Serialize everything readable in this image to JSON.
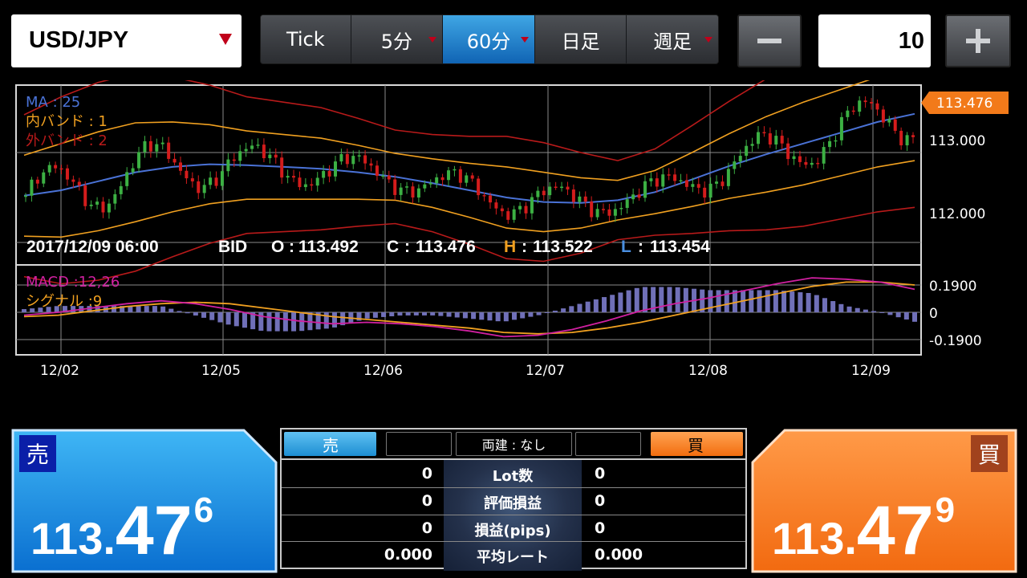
{
  "toolbar": {
    "pair": "USD/JPY",
    "timeframes": [
      {
        "label": "Tick",
        "active": false,
        "has_menu": false
      },
      {
        "label": "5分",
        "active": false,
        "has_menu": true
      },
      {
        "label": "60分",
        "active": true,
        "has_menu": true
      },
      {
        "label": "日足",
        "active": false,
        "has_menu": false
      },
      {
        "label": "週足",
        "active": false,
        "has_menu": true
      }
    ],
    "quantity": "10"
  },
  "chart": {
    "legend": {
      "ma": "MA : 25",
      "inner_band": "内バンド : 1",
      "outer_band": "外バンド : 2"
    },
    "macd_legend": {
      "macd": "MACD :12,26",
      "signal": "シグナル :9"
    },
    "ohlc": {
      "datetime": "2017/12/09 06:00",
      "side": "BID",
      "open_label": "O",
      "open": "113.492",
      "close_label": "C",
      "close": "113.476",
      "high_label": "H",
      "high": "113.522",
      "low_label": "L",
      "low": "113.454"
    },
    "current_price_tag": "113.476",
    "colors": {
      "ma": "#4a72d6",
      "inner_band": "#f0a020",
      "outer_band": "#b81a1a",
      "macd": "#d020a0",
      "signal": "#f0a020",
      "histogram": "#7070b8",
      "price_tag": "#f27a1a",
      "up_candle": "#3cb043",
      "down_candle": "#d41c1c"
    }
  },
  "chart_data": {
    "type": "line",
    "x_dates": [
      "12/02",
      "12/05",
      "12/06",
      "12/07",
      "12/08",
      "12/09"
    ],
    "price_axis_ticks": [
      "113.000",
      "112.000"
    ],
    "price_axis_range": [
      111.75,
      113.75
    ],
    "macd_axis_ticks": [
      "0.1900",
      "0",
      "-0.1900"
    ],
    "series": [
      {
        "name": "MA",
        "values": [
          112.52,
          112.58,
          112.68,
          112.78,
          112.84,
          112.87,
          112.86,
          112.84,
          112.82,
          112.78,
          112.73,
          112.66,
          112.58,
          112.5,
          112.45,
          112.44,
          112.47,
          112.56,
          112.7,
          112.85,
          112.98,
          113.1,
          113.22,
          113.34,
          113.43
        ]
      },
      {
        "name": "MACD",
        "values": [
          -0.02,
          0.0,
          0.03,
          0.06,
          0.08,
          0.06,
          0.02,
          -0.03,
          -0.06,
          -0.08,
          -0.07,
          -0.08,
          -0.1,
          -0.13,
          -0.17,
          -0.16,
          -0.12,
          -0.06,
          0.01,
          0.06,
          0.1,
          0.15,
          0.2,
          0.24,
          0.23,
          0.21,
          0.16
        ]
      },
      {
        "name": "シグナル",
        "values": [
          -0.03,
          -0.02,
          0.01,
          0.04,
          0.06,
          0.07,
          0.06,
          0.03,
          0.0,
          -0.03,
          -0.05,
          -0.07,
          -0.09,
          -0.11,
          -0.14,
          -0.15,
          -0.14,
          -0.11,
          -0.07,
          -0.02,
          0.03,
          0.08,
          0.13,
          0.18,
          0.21,
          0.21,
          0.19
        ]
      }
    ]
  },
  "position": {
    "sell_header": "売",
    "buy_header": "買",
    "hedge": "両建 : なし",
    "rows": [
      {
        "label": "Lot数",
        "sell": "0",
        "buy": "0"
      },
      {
        "label": "評価損益",
        "sell": "0",
        "buy": "0"
      },
      {
        "label": "損益(pips)",
        "sell": "0",
        "buy": "0"
      },
      {
        "label": "平均レート",
        "sell": "0.000",
        "buy": "0.000"
      }
    ]
  },
  "sell": {
    "badge": "売",
    "price_prefix": "113.",
    "price_big": "47",
    "price_super": "6",
    "color": "#1e9ae8"
  },
  "buy": {
    "badge": "買",
    "price_prefix": "113.",
    "price_big": "47",
    "price_super": "9",
    "color": "#f47a1a"
  }
}
